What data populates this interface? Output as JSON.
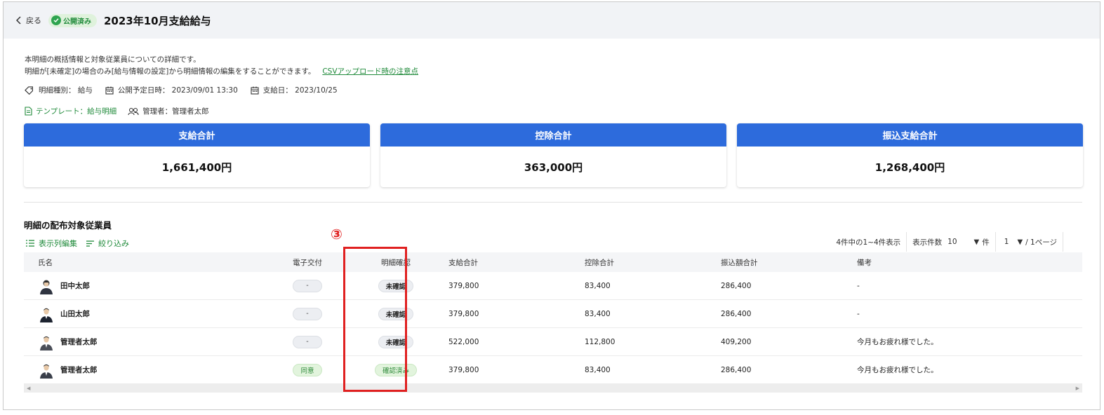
{
  "header": {
    "back_label": "戻る",
    "status_badge": "公開済み",
    "title": "2023年10月支給給与"
  },
  "description": {
    "line1": "本明細の概括情報と対象従業員についての詳細です。",
    "line2": "明細が[未確定]の場合のみ[給与情報の設定]から明細情報の編集をすることができます。",
    "csv_link": "CSVアップロード時の注意点"
  },
  "meta": {
    "type": "明細種別： 給与",
    "publish": "公開予定日時： 2023/09/01 13:30",
    "payday": "支給日： 2023/10/25",
    "template": "テンプレート：給与明細",
    "manager": "管理者：管理者太郎"
  },
  "cards": [
    {
      "label": "支給合計",
      "value": "1,661,400円"
    },
    {
      "label": "控除合計",
      "value": "363,000円"
    },
    {
      "label": "振込支給合計",
      "value": "1,268,400円"
    }
  ],
  "section": {
    "title": "明細の配布対象従業員",
    "annotation": "③",
    "tool_columns": "表示列編集",
    "tool_filter": "絞り込み"
  },
  "pager": {
    "range": "4件中の1~4件表示",
    "per_page_label": "表示件数",
    "per_page_value": "10",
    "per_page_unit": "件",
    "page_value": "1",
    "page_total": "/ 1ページ"
  },
  "table": {
    "headers": [
      "氏名",
      "電子交付",
      "明細確認",
      "支給合計",
      "控除合計",
      "振込額合計",
      "備考"
    ],
    "rows": [
      {
        "name": "田中太郎",
        "esig": "-",
        "confirm": "未確認",
        "pay": "379,800",
        "ded": "83,400",
        "transfer": "286,400",
        "note": "-"
      },
      {
        "name": "山田太郎",
        "esig": "-",
        "confirm": "未確認",
        "pay": "379,800",
        "ded": "83,400",
        "transfer": "286,400",
        "note": "-"
      },
      {
        "name": "管理者太郎",
        "esig": "-",
        "confirm": "未確認",
        "pay": "522,000",
        "ded": "112,800",
        "transfer": "409,200",
        "note": "今月もお疲れ様でした。"
      },
      {
        "name": "管理者太郎",
        "esig": "同意",
        "confirm": "確認済み",
        "pay": "379,800",
        "ded": "83,400",
        "transfer": "286,400",
        "note": "今月もお疲れ様でした。"
      }
    ]
  },
  "colors": {
    "accent_blue": "#2d6bdc",
    "accent_green": "#1f8a3a",
    "highlight_red": "#e02020"
  }
}
